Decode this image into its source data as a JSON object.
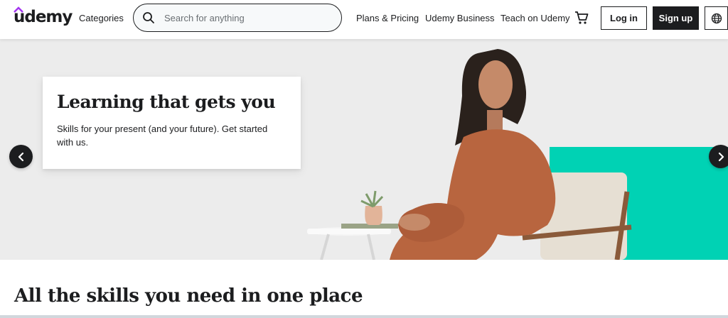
{
  "header": {
    "logo_text": "udemy",
    "categories": "Categories",
    "search_placeholder": "Search for anything",
    "plans": "Plans & Pricing",
    "business": "Udemy Business",
    "teach": "Teach on Udemy",
    "login": "Log in",
    "signup": "Sign up",
    "cart_icon": "cart-icon",
    "globe_icon": "globe-icon"
  },
  "hero": {
    "title": "Learning that gets you",
    "subtitle": "Skills for your present (and your future). Get started with us.",
    "accent_color": "#00d2b4"
  },
  "section": {
    "title": "All the skills you need in one place"
  }
}
